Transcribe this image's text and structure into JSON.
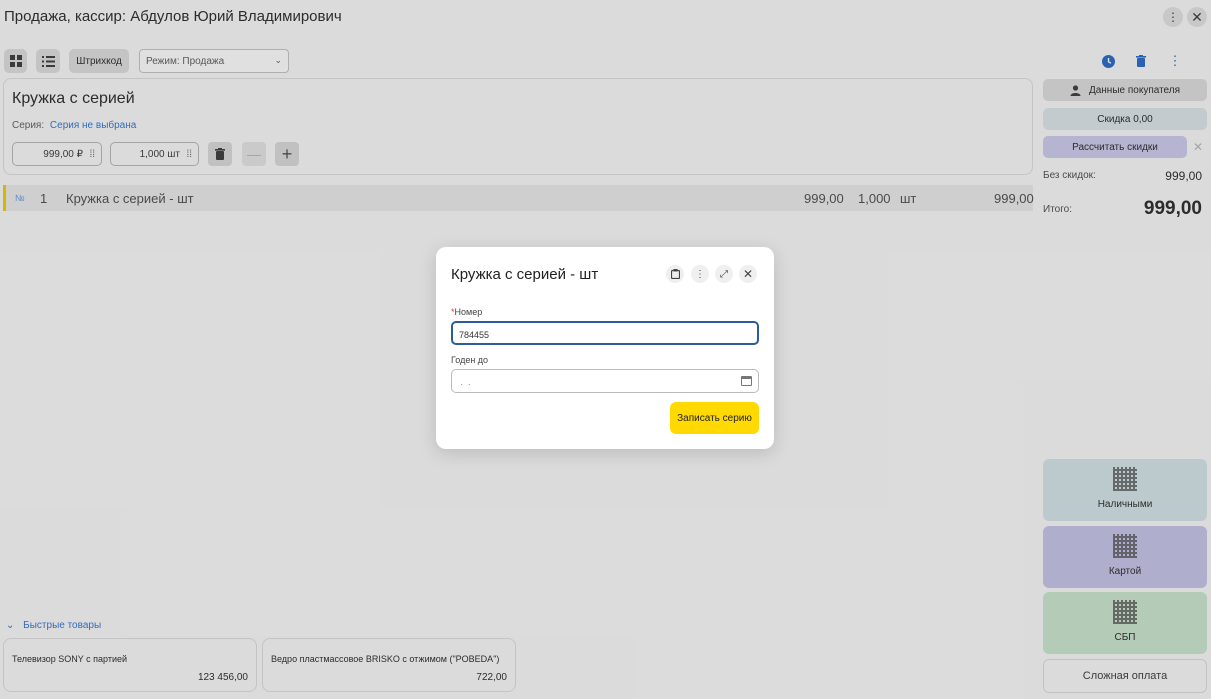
{
  "window": {
    "title": "Продажа, кассир: Абдулов Юрий Владимирович"
  },
  "toolbar": {
    "barcode_label": "Штрихкод",
    "mode_value": "Режим: Продажа"
  },
  "product": {
    "name": "Кружка с серией",
    "series_label": "Серия:",
    "series_value": "Серия не выбрана",
    "price": "999,00 ₽",
    "quantity": "1,000 шт"
  },
  "receipt": {
    "rows": [
      {
        "num_sign": "№",
        "index": "1",
        "name": "Кружка с серией - шт",
        "price": "999,00",
        "qty": "1,000",
        "unit": "шт",
        "total": "999,00"
      }
    ]
  },
  "quick": {
    "header": "Быстрые товары",
    "items": [
      {
        "name": "Телевизор SONY с партией",
        "price": "123 456,00"
      },
      {
        "name": "Ведро пластмассовое BRISKO с отжимом (\"POBEDA\")",
        "price": "722,00"
      }
    ]
  },
  "right_panel": {
    "buyer_button": "Данные покупателя",
    "discount_button": "Скидка 0,00",
    "calc_discounts_button": "Рассчитать скидки",
    "no_discount_label": "Без скидок:",
    "no_discount_value": "999,00",
    "total_label": "Итого:",
    "total_value": "999,00",
    "payments": [
      "Наличными",
      "Картой",
      "СБП"
    ],
    "complex_payment": "Сложная оплата"
  },
  "modal": {
    "title": "Кружка с серией - шт",
    "number_required": "*",
    "number_label": "Номер",
    "number_value": "784455",
    "expiry_label": "Годен до",
    "expiry_value": " .  .",
    "save_button": "Записать серию"
  },
  "colors": {
    "accent_yellow": "#ffd900",
    "link_blue": "#3a7bd5",
    "pay_cash": "#d8e6ea",
    "pay_card": "#c9c6ea",
    "pay_sbp": "#cde8d2",
    "calc_discounts": "#cfcdee"
  },
  "icons": [
    "grid-view-icon",
    "list-view-icon",
    "history-icon",
    "trash-icon",
    "more-vertical-icon",
    "close-icon",
    "expand-icon",
    "calendar-icon",
    "user-icon",
    "qr-code-icon"
  ]
}
